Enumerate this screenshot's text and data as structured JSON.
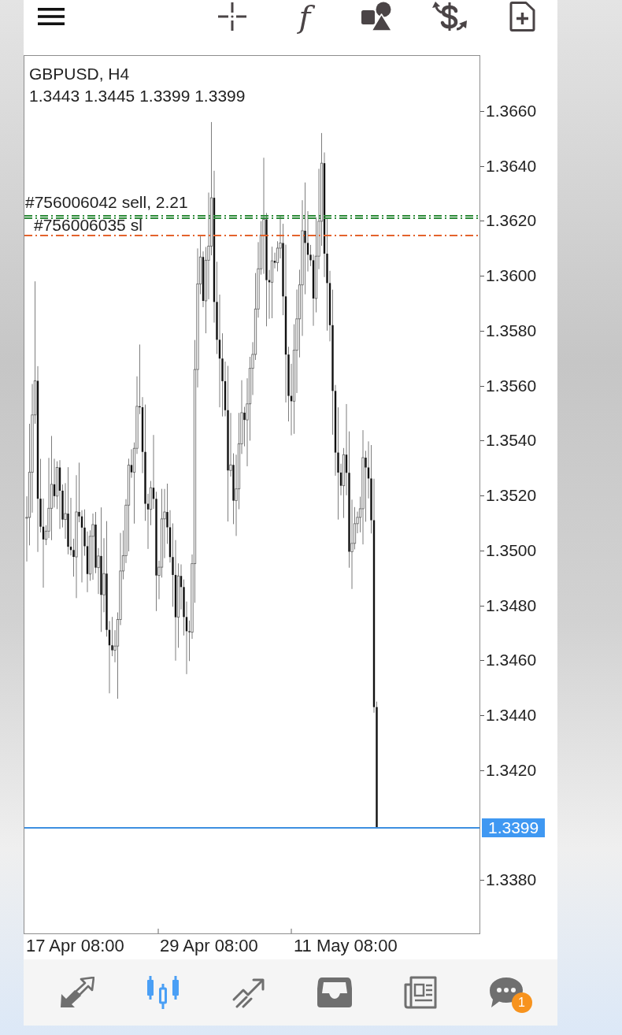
{
  "toolbar": {
    "function_glyph": "f"
  },
  "chart": {
    "symbol": "GBPUSD, H4",
    "ohlc": "1.3443 1.3445 1.3399 1.3399",
    "order_lines": [
      {
        "kind": "order",
        "label": "#756006042 sell, 2.21",
        "color": "#2e8b3a"
      },
      {
        "kind": "stop_loss",
        "label": "#756006035 sl",
        "color": "#e4632c"
      }
    ],
    "price_labels": [
      "1.3660",
      "1.3640",
      "1.3620",
      "1.3600",
      "1.3580",
      "1.3560",
      "1.3540",
      "1.3520",
      "1.3500",
      "1.3480",
      "1.3460",
      "1.3440",
      "1.3420",
      "1.3380"
    ],
    "current_price": "1.3399",
    "time_labels": [
      "17 Apr 08:00",
      "29 Apr 08:00",
      "11 May 08:00"
    ]
  },
  "nav": {
    "items": [
      {
        "selected": false
      },
      {
        "selected": true
      },
      {
        "selected": false
      },
      {
        "selected": false
      },
      {
        "selected": false
      },
      {
        "selected": false,
        "badge": "1"
      }
    ]
  }
}
